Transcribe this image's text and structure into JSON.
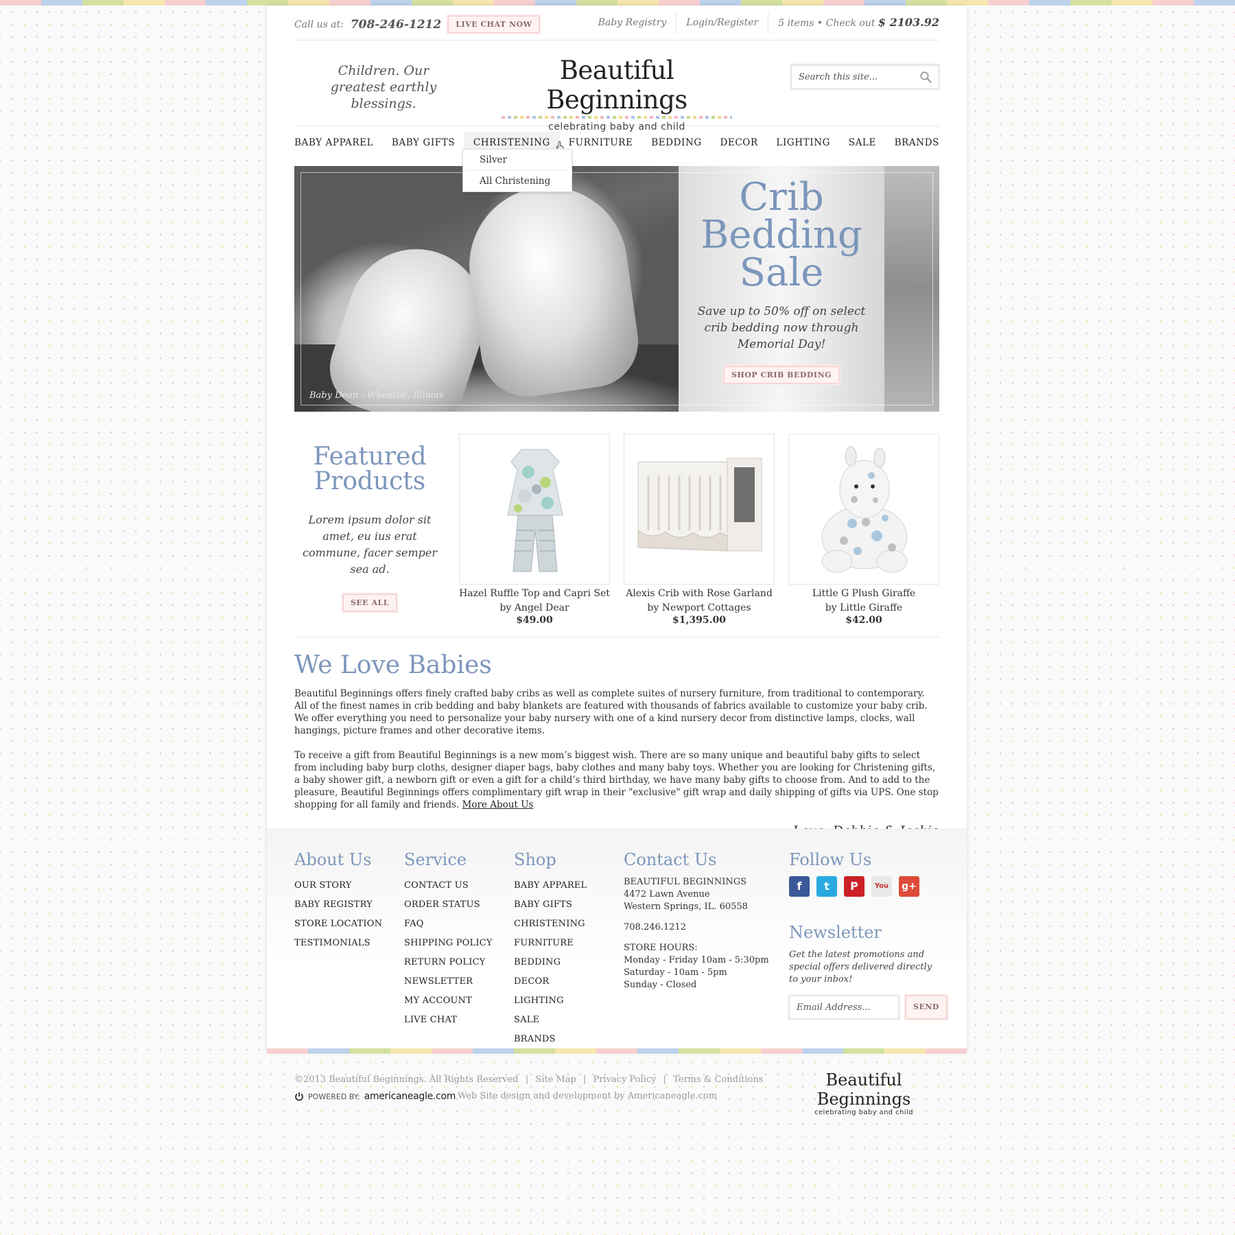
{
  "topbar": {
    "call_label": "Call us at:",
    "phone": "708-246-1212",
    "live_chat": "LIVE CHAT NOW",
    "registry": "Baby Registry",
    "login": "Login/Register",
    "cart_items": "5 items",
    "bullet": "•",
    "checkout": "Check out",
    "cart_total": "$ 2103.92"
  },
  "header": {
    "tagline": "Children. Our greatest earthly blessings.",
    "logo_title": "Beautiful Beginnings",
    "logo_subtitle": "celebrating baby and child",
    "search_placeholder": "Search this site..."
  },
  "nav": {
    "items": [
      "BABY APPAREL",
      "BABY GIFTS",
      "CHRISTENING",
      "FURNITURE",
      "BEDDING",
      "DECOR",
      "LIGHTING",
      "SALE",
      "BRANDS"
    ],
    "active": "CHRISTENING",
    "dropdown": [
      "Silver",
      "All Christening"
    ]
  },
  "hero": {
    "title": "Crib Bedding Sale",
    "description": "Save up to 50% off on select crib bedding now through Memorial Day!",
    "button": "SHOP CRIB BEDDING",
    "photo_credit": "Baby Dean - Wheaton, Illinois"
  },
  "featured": {
    "title": "Featured Products",
    "description": "Lorem ipsum dolor sit amet, eu ius erat commune, facer semper sea ad.",
    "button": "SEE ALL",
    "products": [
      {
        "name": "Hazel Ruffle Top and Capri Set",
        "brand": "by Angel Dear",
        "price": "$49.00"
      },
      {
        "name": "Alexis Crib with Rose Garland",
        "brand": "by Newport Cottages",
        "price": "$1,395.00"
      },
      {
        "name": "Little G Plush Giraffe",
        "brand": "by Little Giraffe",
        "price": "$42.00"
      }
    ]
  },
  "about": {
    "title": "We Love Babies",
    "para1": "Beautiful Beginnings offers finely crafted baby cribs as well as complete suites of nursery furniture, from traditional to contemporary. All of the finest names in crib bedding and baby blankets are featured with thousands of fabrics available to customize your baby crib. We offer everything you need to personalize your baby nursery with one of a kind nursery decor from distinctive lamps, clocks, wall hangings, picture frames and other decorative items.",
    "para2": "To receive a gift from Beautiful Beginnings is a new mom’s biggest wish. There are so many unique and beautiful baby gifts to select from including baby burp cloths, designer diaper bags, baby clothes and many baby toys. Whether you are looking for Christening gifts, a baby shower gift, a newborn gift or even a gift for a child’s third birthday, we have many baby gifts to choose from. And to add to the pleasure, Beautiful Beginnings offers complimentary gift wrap in their \"exclusive\" gift wrap and daily shipping of gifts via UPS. One stop shopping for all family and friends.",
    "more_link": "More About Us",
    "signature": "Love, Debbie & Jackie"
  },
  "footer": {
    "about": {
      "title": "About Us",
      "links": [
        "OUR STORY",
        "BABY REGISTRY",
        "STORE LOCATION",
        "TESTIMONIALS"
      ]
    },
    "service": {
      "title": "Service",
      "links": [
        "CONTACT US",
        "ORDER STATUS",
        "FAQ",
        "SHIPPING POLICY",
        "RETURN POLICY",
        "NEWSLETTER",
        "MY ACCOUNT",
        "LIVE CHAT"
      ]
    },
    "shop": {
      "title": "Shop",
      "links": [
        "BABY APPAREL",
        "BABY GIFTS",
        "CHRISTENING",
        "FURNITURE",
        "BEDDING",
        "DECOR",
        "LIGHTING",
        "SALE",
        "BRANDS"
      ]
    },
    "contact": {
      "title": "Contact Us",
      "name": "BEAUTIFUL BEGINNINGS",
      "street": "4472 Lawn Avenue",
      "city": "Western Springs, IL. 60558",
      "phone": "708.246.1212",
      "hours_label": "STORE HOURS:",
      "hours": [
        "Monday - Friday 10am - 5:30pm",
        "Saturday - 10am - 5pm",
        "Sunday - Closed"
      ]
    },
    "follow": {
      "title": "Follow Us",
      "icons": [
        "facebook-icon",
        "twitter-icon",
        "pinterest-icon",
        "youtube-icon",
        "google-plus-icon"
      ]
    },
    "newsletter": {
      "title": "Newsletter",
      "description": "Get the latest promotions and special offers delivered directly to your inbox!",
      "placeholder": "Email Address...",
      "button": "SEND"
    }
  },
  "bottom": {
    "copyright": "©2013 Beautiful Beginnings. All Rights Reserved",
    "site_map": "Site Map",
    "privacy": "Privacy Policy",
    "terms": "Terms & Conditions",
    "separator": "|",
    "powered_by": "POWERED BY:",
    "powered_brand": "americaneagle.com",
    "credit": "Web Site design and development by Americaneagle.com",
    "logo_title": "Beautiful Beginnings",
    "logo_subtitle": "celebrating baby and child"
  },
  "colors": {
    "accent_blue": "#7c96bb",
    "pink_button": "#fff3f2",
    "facebook": "#3b5998",
    "twitter": "#29a9e0",
    "pinterest": "#cb2027",
    "youtube": "#e8e8e8",
    "google_plus": "#dd4b39"
  }
}
